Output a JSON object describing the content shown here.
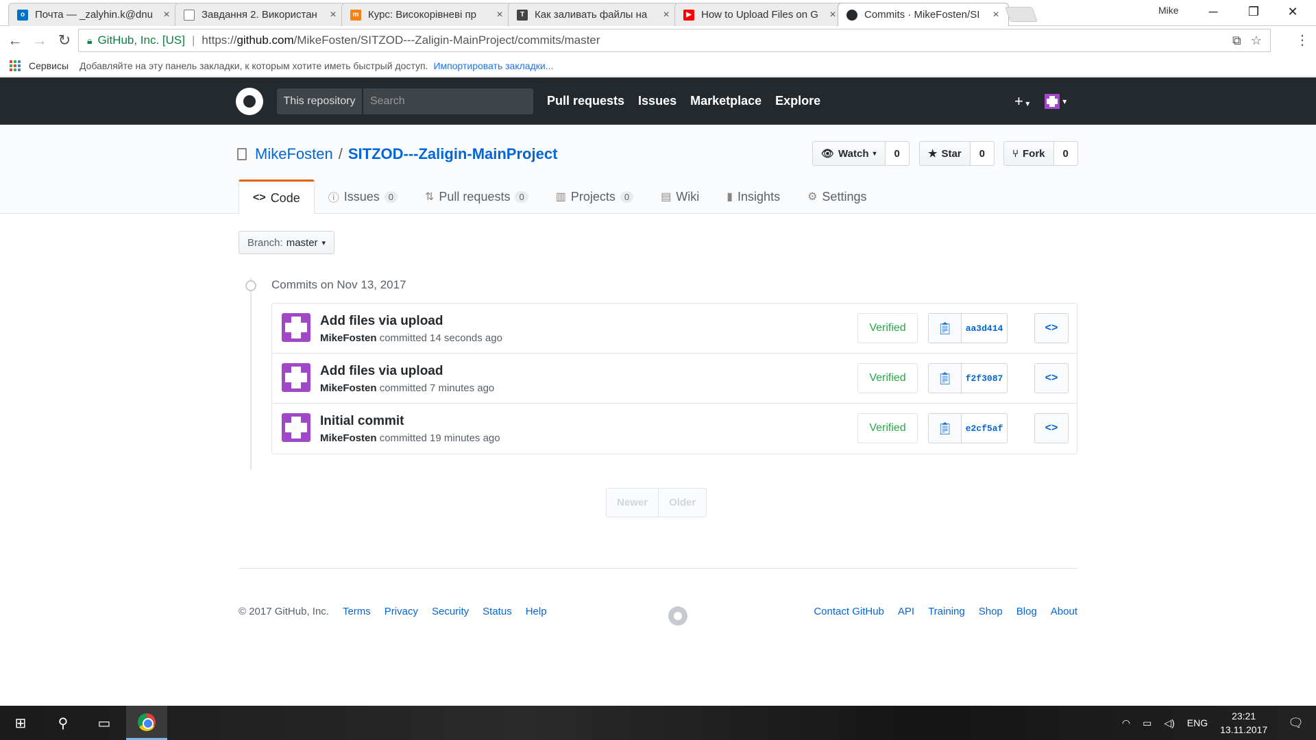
{
  "browser": {
    "tabs": [
      {
        "title": "Почта — _zalyhin.k@dnu",
        "favicon": "outlook-icon",
        "color": "#0072c6"
      },
      {
        "title": "Завдання 2. Використан",
        "favicon": "doc-icon",
        "color": "#666666"
      },
      {
        "title": "Курс: Високорівневі пр",
        "favicon": "moodle-icon",
        "color": "#f98012"
      },
      {
        "title": "Как заливать файлы на",
        "favicon": "t-icon",
        "color": "#444444"
      },
      {
        "title": "How to Upload Files on G",
        "favicon": "youtube-icon",
        "color": "#ff0000"
      },
      {
        "title": "Commits · MikeFosten/SI",
        "favicon": "github-icon",
        "color": "#24292e"
      }
    ],
    "profile_name": "Mike",
    "address": {
      "org": "GitHub, Inc. [US]",
      "scheme": "https://",
      "host": "github.com",
      "path": "/MikeFosten/SITZOD---Zaligin-MainProject/commits/master"
    },
    "bookmarks": {
      "apps_label": "Сервисы",
      "hint": "Добавляйте на эту панель закладки, к которым хотите иметь быстрый доступ.",
      "import_link": "Импортировать закладки..."
    }
  },
  "header": {
    "scope_label": "This repository",
    "search_placeholder": "Search",
    "nav": [
      "Pull requests",
      "Issues",
      "Marketplace",
      "Explore"
    ]
  },
  "repo": {
    "owner": "MikeFosten",
    "name": "SITZOD---Zaligin-MainProject",
    "watch_label": "Watch",
    "watch_count": "0",
    "star_label": "Star",
    "star_count": "0",
    "fork_label": "Fork",
    "fork_count": "0",
    "tabs": [
      {
        "label": "Code",
        "icon": "code-icon",
        "count": ""
      },
      {
        "label": "Issues",
        "icon": "issue-icon",
        "count": "0"
      },
      {
        "label": "Pull requests",
        "icon": "pull-request-icon",
        "count": "0"
      },
      {
        "label": "Projects",
        "icon": "project-icon",
        "count": "0"
      },
      {
        "label": "Wiki",
        "icon": "book-icon",
        "count": ""
      },
      {
        "label": "Insights",
        "icon": "graph-icon",
        "count": ""
      },
      {
        "label": "Settings",
        "icon": "gear-icon",
        "count": ""
      }
    ]
  },
  "branch": {
    "prefix": "Branch:",
    "name": "master"
  },
  "commits": {
    "date_heading": "Commits on Nov 13, 2017",
    "items": [
      {
        "message": "Add files via upload",
        "author": "MikeFosten",
        "action": "committed",
        "when": "14 seconds ago",
        "status": "Verified",
        "sha": "aa3d414"
      },
      {
        "message": "Add files via upload",
        "author": "MikeFosten",
        "action": "committed",
        "when": "7 minutes ago",
        "status": "Verified",
        "sha": "f2f3087"
      },
      {
        "message": "Initial commit",
        "author": "MikeFosten",
        "action": "committed",
        "when": "19 minutes ago",
        "status": "Verified",
        "sha": "e2cf5af"
      }
    ]
  },
  "pager": {
    "newer": "Newer",
    "older": "Older"
  },
  "footer": {
    "copyright": "© 2017 GitHub, Inc.",
    "left_links": [
      "Terms",
      "Privacy",
      "Security",
      "Status",
      "Help"
    ],
    "right_links": [
      "Contact GitHub",
      "API",
      "Training",
      "Shop",
      "Blog",
      "About"
    ]
  },
  "taskbar": {
    "language": "ENG",
    "time": "23:21",
    "date": "13.11.2017"
  }
}
